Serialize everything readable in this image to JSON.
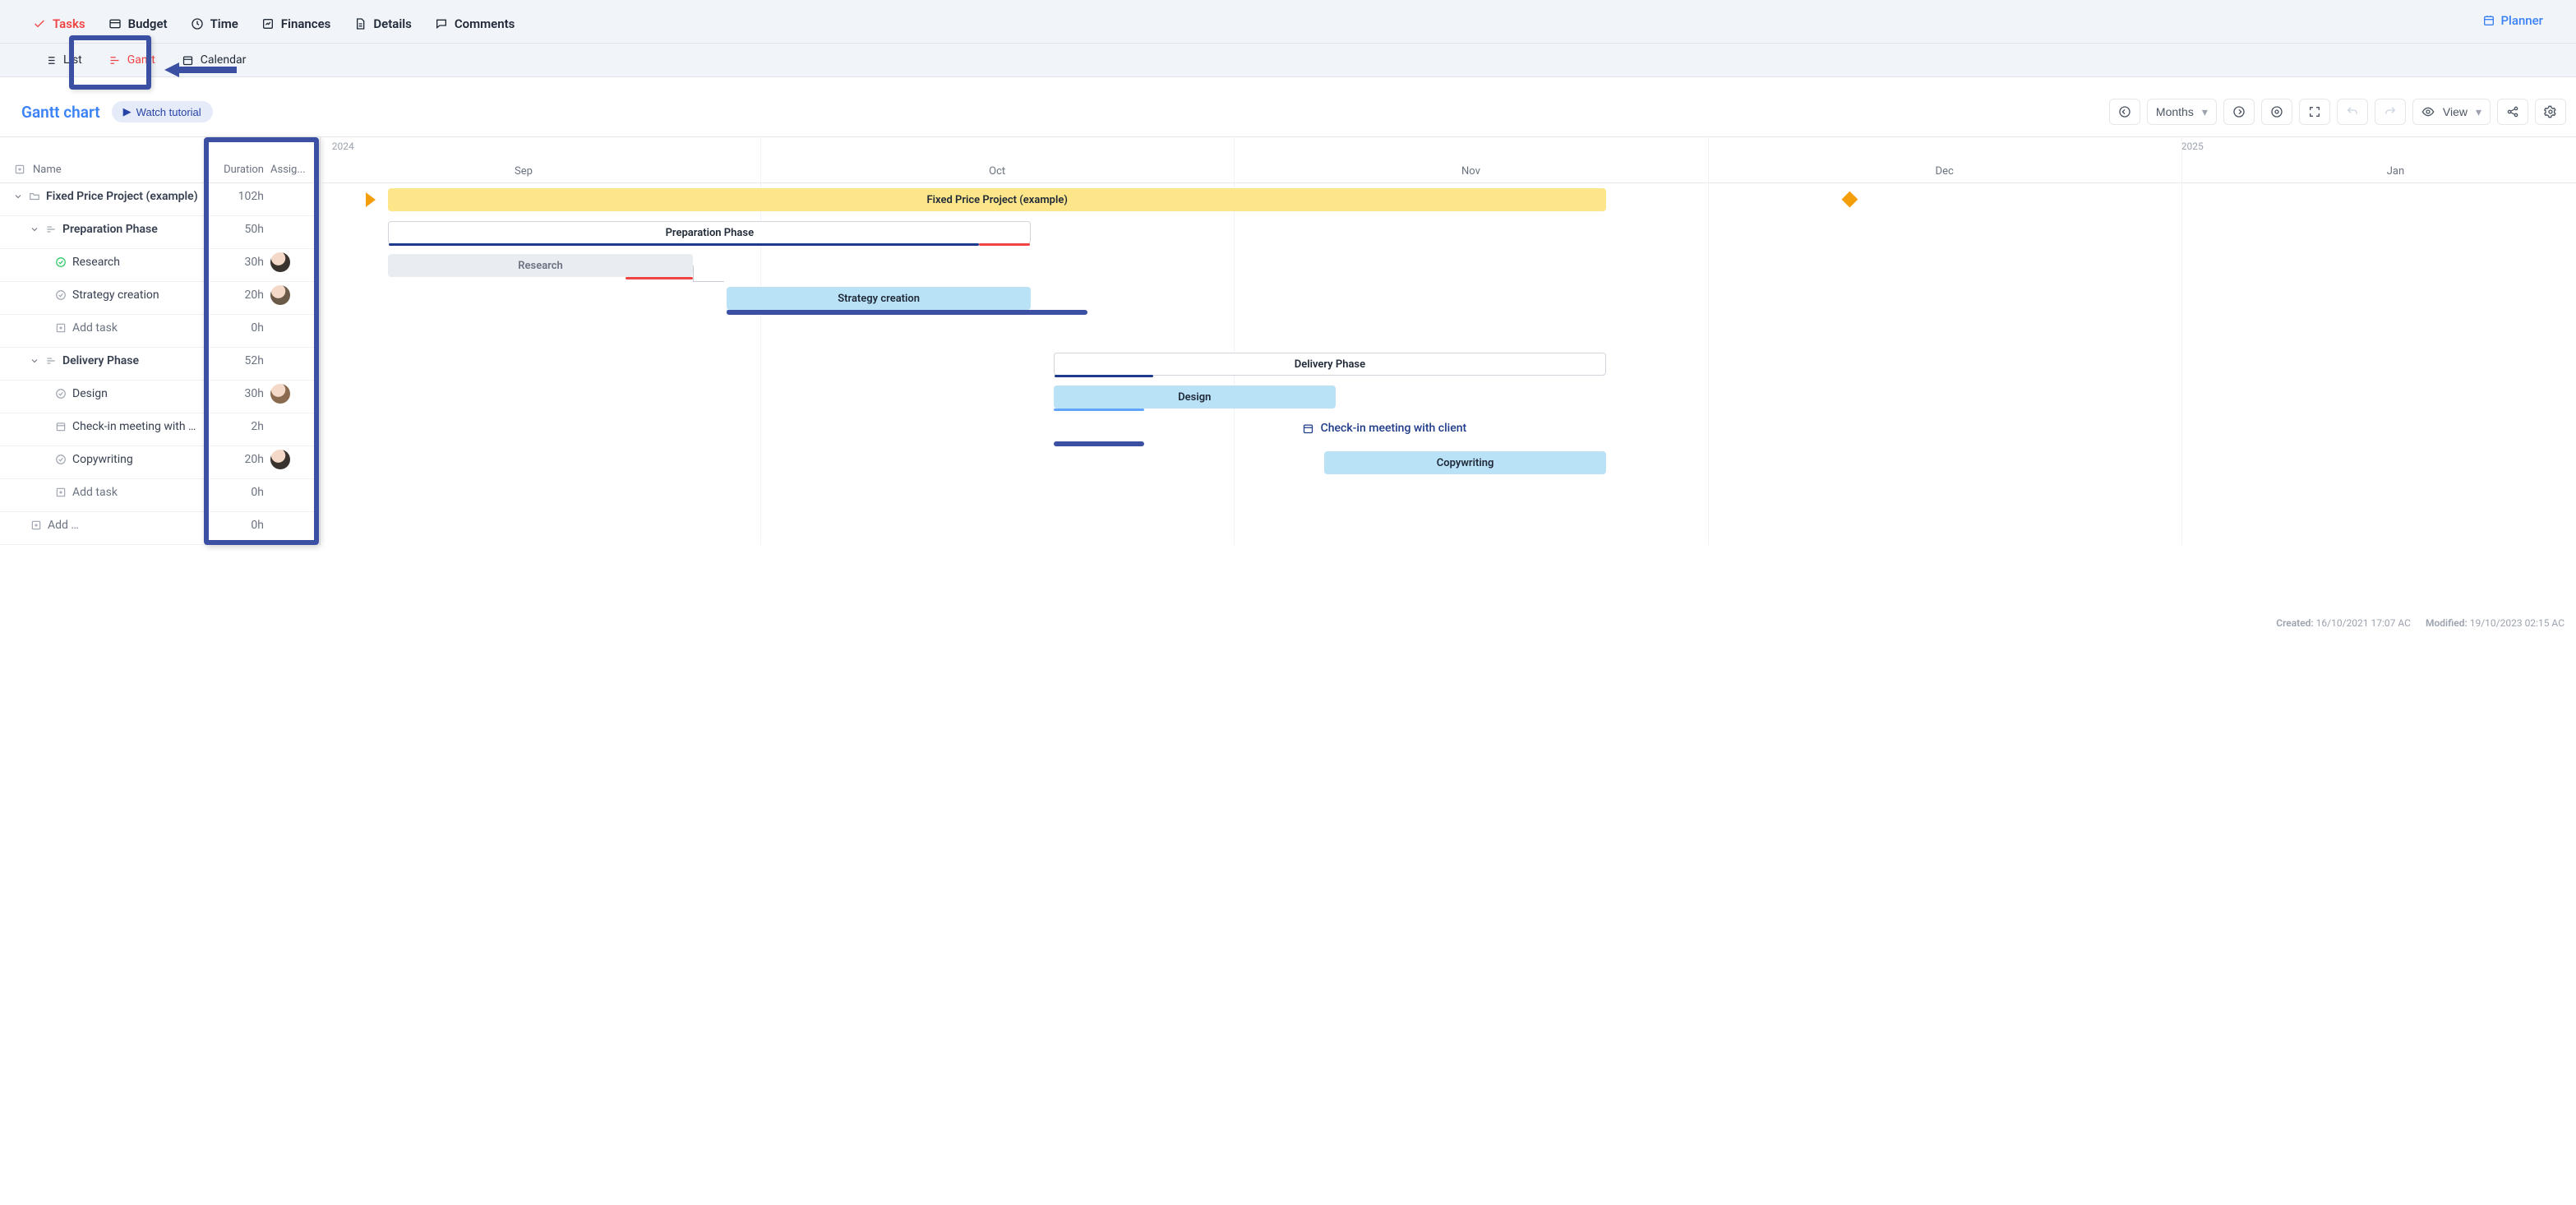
{
  "nav": {
    "tabs": [
      "Tasks",
      "Budget",
      "Time",
      "Finances",
      "Details",
      "Comments"
    ],
    "planner": "Planner",
    "subtabs": [
      "List",
      "Gantt",
      "Calendar"
    ]
  },
  "header": {
    "title": "Gantt chart",
    "tutorial": "Watch tutorial",
    "zoom": "Months",
    "view": "View"
  },
  "columns": {
    "name": "Name",
    "duration": "Duration",
    "assignee": "Assig..."
  },
  "timeline": {
    "years": [
      {
        "label": "2024",
        "leftPct": 0.5
      },
      {
        "label": "2025",
        "leftPct": 82.5
      }
    ],
    "months": [
      {
        "label": "Sep",
        "centerPct": 9
      },
      {
        "label": "Oct",
        "centerPct": 30
      },
      {
        "label": "Nov",
        "centerPct": 51
      },
      {
        "label": "Dec",
        "centerPct": 72
      },
      {
        "label": "Jan",
        "centerPct": 92
      }
    ],
    "gridPct": [
      0,
      19.5,
      40.5,
      61.5,
      82.5
    ]
  },
  "rows": [
    {
      "id": "proj",
      "type": "project",
      "indent": 0,
      "label": "Fixed Price Project (example)",
      "duration": "102h",
      "bar": {
        "kind": "project",
        "leftPct": 3,
        "widthPct": 54,
        "label": "Fixed Price Project (example)"
      },
      "milestonePct": 67.5,
      "triPct": 2
    },
    {
      "id": "phase1",
      "type": "phase",
      "indent": 1,
      "label": "Preparation Phase",
      "duration": "50h",
      "bar": {
        "kind": "phase",
        "leftPct": 3,
        "widthPct": 28.5,
        "label": "Preparation Phase",
        "underlines": [
          {
            "color": "#1e3a8a",
            "leftPct": 0,
            "widthPct": 92
          },
          {
            "color": "#ef4444",
            "leftPct": 92,
            "widthPct": 8
          }
        ]
      }
    },
    {
      "id": "research",
      "type": "task",
      "indent": 2,
      "label": "Research",
      "duration": "30h",
      "avatar": "a1",
      "bar": {
        "kind": "research",
        "leftPct": 3,
        "widthPct": 13.5,
        "label": "Research",
        "underlines": [
          {
            "color": "#ef4444",
            "leftPct": 78,
            "widthPct": 22
          }
        ]
      },
      "depFrom": true
    },
    {
      "id": "strategy",
      "type": "task",
      "indent": 2,
      "label": "Strategy creation",
      "duration": "20h",
      "avatar": "a2",
      "bar": {
        "kind": "task",
        "leftPct": 18,
        "widthPct": 13.5,
        "label": "Strategy creation",
        "underlines": [
          {
            "color": "#60a5fa",
            "leftPct": 0,
            "widthPct": 100
          }
        ]
      },
      "annotStrip": {
        "leftPct": 18,
        "widthPct": 16
      }
    },
    {
      "id": "add1",
      "type": "add",
      "indent": 2,
      "label": "Add task",
      "duration": "0h"
    },
    {
      "id": "phase2",
      "type": "phase",
      "indent": 1,
      "label": "Delivery Phase",
      "duration": "52h",
      "bar": {
        "kind": "phase",
        "leftPct": 32.5,
        "widthPct": 24.5,
        "label": "Delivery Phase",
        "underlines": [
          {
            "color": "#1e3a8a",
            "leftPct": 0,
            "widthPct": 18
          }
        ]
      }
    },
    {
      "id": "design",
      "type": "task",
      "indent": 2,
      "label": "Design",
      "duration": "30h",
      "avatar": "a3",
      "bar": {
        "kind": "task",
        "leftPct": 32.5,
        "widthPct": 12.5,
        "label": "Design",
        "underlines": [
          {
            "color": "#60a5fa",
            "leftPct": 0,
            "widthPct": 32
          }
        ]
      }
    },
    {
      "id": "meeting",
      "type": "event",
      "indent": 2,
      "label": "Check-in meeting with …",
      "duration": "2h",
      "eventLabel": "Check-in meeting with client",
      "eventPct": 43.5,
      "annotStrip": {
        "leftPct": 32.5,
        "widthPct": 4
      }
    },
    {
      "id": "copy",
      "type": "task",
      "indent": 2,
      "label": "Copywriting",
      "duration": "20h",
      "avatar": "a1",
      "bar": {
        "kind": "task",
        "leftPct": 44.5,
        "widthPct": 12.5,
        "label": "Copywriting"
      }
    },
    {
      "id": "add2",
      "type": "add",
      "indent": 2,
      "label": "Add task",
      "duration": "0h"
    },
    {
      "id": "add3",
      "type": "add",
      "indent": 1,
      "label": "Add …",
      "duration": "0h"
    }
  ],
  "footer": {
    "created_label": "Created:",
    "created": "16/10/2021 17:07 AC",
    "modified_label": "Modified:",
    "modified": "19/10/2023 02:15 AC"
  }
}
